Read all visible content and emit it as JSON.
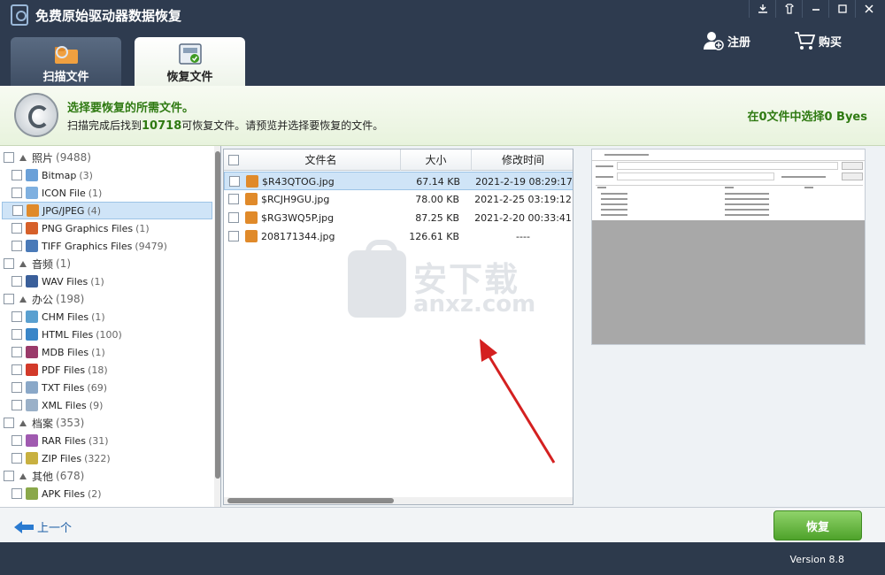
{
  "app": {
    "title": "免费原始驱动器数据恢复"
  },
  "window_buttons": [
    "download-icon",
    "skin-icon",
    "minimize-icon",
    "maximize-icon",
    "close-icon"
  ],
  "tabs": [
    {
      "label": "扫描文件",
      "active": false
    },
    {
      "label": "恢复文件",
      "active": true
    }
  ],
  "top_actions": {
    "register": "注册",
    "buy": "购买"
  },
  "banner": {
    "title": "选择要恢复的所需文件。",
    "text_prefix": "扫描完成后找到",
    "count": "10718",
    "text_suffix": "可恢复文件。请预览并选择要恢复的文件。",
    "selection": "在0文件中选择0 Byes"
  },
  "tree": [
    {
      "type": "cat",
      "label": "照片",
      "count": "(9488)"
    },
    {
      "type": "item",
      "label": "Bitmap",
      "count": "(3)",
      "icon": "#6aa0d8"
    },
    {
      "type": "item",
      "label": "ICON File",
      "count": "(1)",
      "icon": "#7fb0e0"
    },
    {
      "type": "item",
      "label": "JPG/JPEG",
      "count": "(4)",
      "icon": "#e08a2a",
      "selected": true
    },
    {
      "type": "item",
      "label": "PNG Graphics Files",
      "count": "(1)",
      "icon": "#d6602a"
    },
    {
      "type": "item",
      "label": "TIFF Graphics Files",
      "count": "(9479)",
      "icon": "#4a7ab8"
    },
    {
      "type": "cat",
      "label": "音频",
      "count": "(1)"
    },
    {
      "type": "item",
      "label": "WAV Files",
      "count": "(1)",
      "icon": "#3a5f9a"
    },
    {
      "type": "cat",
      "label": "办公",
      "count": "(198)"
    },
    {
      "type": "item",
      "label": "CHM Files",
      "count": "(1)",
      "icon": "#5aa0d0"
    },
    {
      "type": "item",
      "label": "HTML Files",
      "count": "(100)",
      "icon": "#3a86c8"
    },
    {
      "type": "item",
      "label": "MDB Files",
      "count": "(1)",
      "icon": "#9a3a6a"
    },
    {
      "type": "item",
      "label": "PDF Files",
      "count": "(18)",
      "icon": "#d23a2a"
    },
    {
      "type": "item",
      "label": "TXT Files",
      "count": "(69)",
      "icon": "#8aa8c8"
    },
    {
      "type": "item",
      "label": "XML Files",
      "count": "(9)",
      "icon": "#9ab0c8"
    },
    {
      "type": "cat",
      "label": "档案",
      "count": "(353)"
    },
    {
      "type": "item",
      "label": "RAR Files",
      "count": "(31)",
      "icon": "#a05ab0"
    },
    {
      "type": "item",
      "label": "ZIP Files",
      "count": "(322)",
      "icon": "#c8b040"
    },
    {
      "type": "cat",
      "label": "其他",
      "count": "(678)"
    },
    {
      "type": "item",
      "label": "APK Files",
      "count": "(2)",
      "icon": "#8aa84a"
    }
  ],
  "file_list": {
    "columns": [
      "文件名",
      "大小",
      "修改时间"
    ],
    "rows": [
      {
        "name": "$R43QTOG.jpg",
        "size": "67.14 KB",
        "date": "2021-2-19 08:29:17",
        "selected": true
      },
      {
        "name": "$RCJH9GU.jpg",
        "size": "78.00 KB",
        "date": "2021-2-25 03:19:12",
        "selected": false
      },
      {
        "name": "$RG3WQ5P.jpg",
        "size": "87.25 KB",
        "date": "2021-2-20 00:33:41",
        "selected": false
      },
      {
        "name": "208171344.jpg",
        "size": "126.61 KB",
        "date": "----",
        "selected": false
      }
    ]
  },
  "watermark": {
    "cn": "安下载",
    "en": "anxz.com"
  },
  "bottom": {
    "back": "上一个",
    "recover": "恢复"
  },
  "status": {
    "version": "Version 8.8"
  },
  "colors": {
    "accent_green": "#2f7a12",
    "titlebar": "#2e3b4f",
    "selection": "#cfe4f7",
    "recover_button": "#5fb034"
  }
}
